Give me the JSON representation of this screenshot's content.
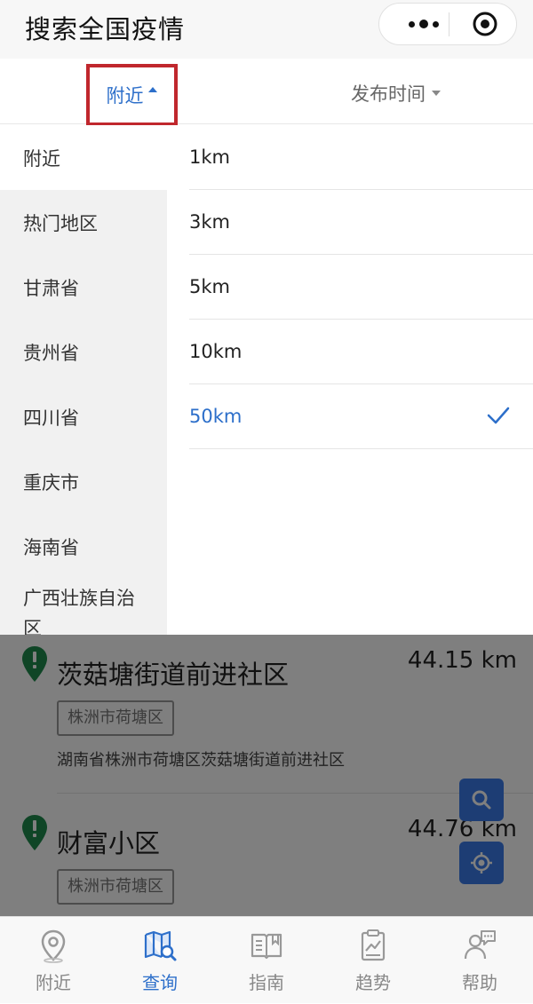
{
  "header": {
    "title": "搜索全国疫情"
  },
  "filter_tabs": {
    "nearby": "附近",
    "publish_time": "发布时间"
  },
  "regions": [
    "附近",
    "热门地区",
    "甘肃省",
    "贵州省",
    "四川省",
    "重庆市",
    "海南省",
    "广西壮族自治区"
  ],
  "distances": [
    "1km",
    "3km",
    "5km",
    "10km",
    "50km"
  ],
  "selected_distance": "50km",
  "results": [
    {
      "name": "茨菇塘街道前进社区",
      "distance": "44.15 km",
      "tag": "株洲市荷塘区",
      "address": "湖南省株洲市荷塘区茨菇塘街道前进社区"
    },
    {
      "name": "财富小区",
      "distance": "44.76 km",
      "tag": "株洲市荷塘区"
    }
  ],
  "bottom_nav": [
    {
      "label": "附近",
      "icon": "location-pin-icon"
    },
    {
      "label": "查询",
      "icon": "map-search-icon",
      "active": true
    },
    {
      "label": "指南",
      "icon": "guide-book-icon"
    },
    {
      "label": "趋势",
      "icon": "trend-clipboard-icon"
    },
    {
      "label": "帮助",
      "icon": "help-person-icon"
    }
  ],
  "colors": {
    "accent": "#2d6fca",
    "highlight_border": "#c0272d",
    "pin_green": "#1e8a4c",
    "fab_blue": "#3b7be8"
  }
}
